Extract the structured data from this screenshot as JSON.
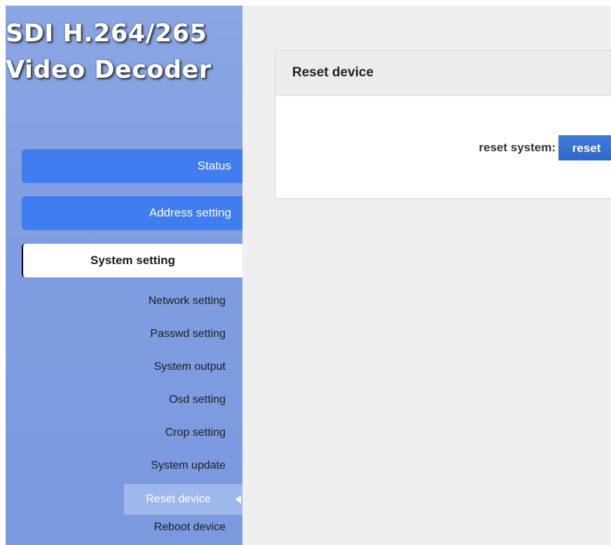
{
  "sidebar": {
    "logo_line1": "SDI H.264/265",
    "logo_line2": "Video Decoder",
    "nav": [
      {
        "label": "Status"
      },
      {
        "label": "Address setting"
      },
      {
        "label": "System setting"
      }
    ],
    "sub_items": [
      {
        "label": "Network setting"
      },
      {
        "label": "Passwd setting"
      },
      {
        "label": "System output"
      },
      {
        "label": "Osd setting"
      },
      {
        "label": "Crop setting"
      },
      {
        "label": "System update"
      },
      {
        "label": "Reset device"
      },
      {
        "label": "Reboot device"
      }
    ]
  },
  "panel": {
    "title": "Reset device",
    "reset_label": "reset system:",
    "reset_button": "reset"
  },
  "colors": {
    "sidebar_bg": "#7f9de0",
    "nav_blue": "#3f7df0",
    "button_blue": "#2e68c8",
    "main_bg": "#efefef"
  }
}
